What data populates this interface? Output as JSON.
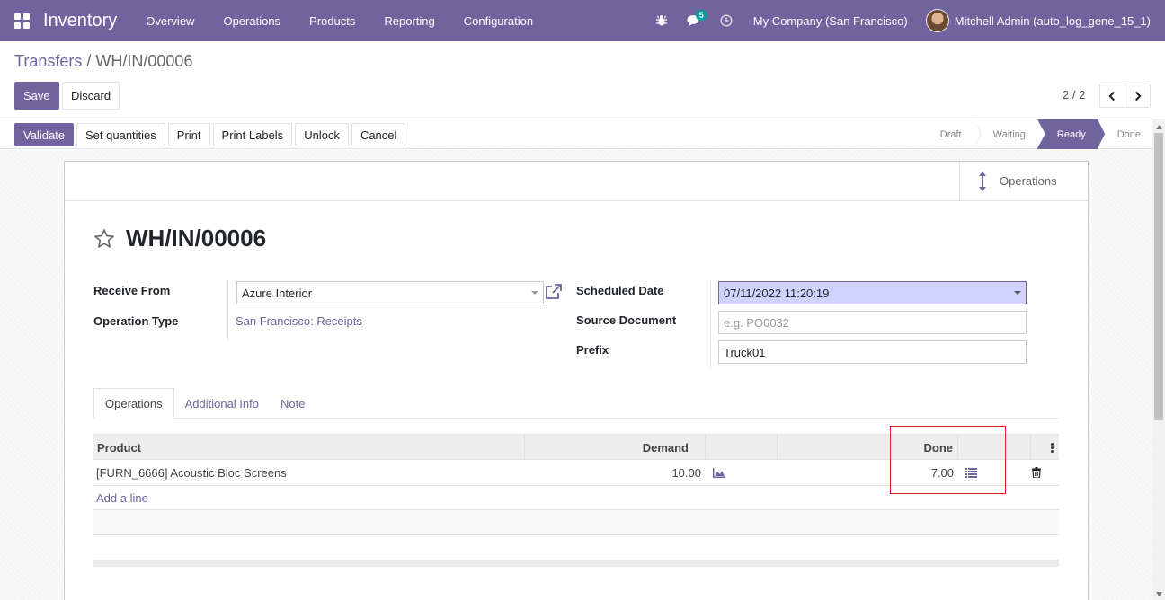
{
  "navbar": {
    "brand": "Inventory",
    "menu": [
      "Overview",
      "Operations",
      "Products",
      "Reporting",
      "Configuration"
    ],
    "chat_badge": "5",
    "company": "My Company (San Francisco)",
    "user": "Mitchell Admin (auto_log_gene_15_1)",
    "colors": {
      "bar": "#71639e"
    }
  },
  "breadcrumb": {
    "parent": "Transfers",
    "separator": "/",
    "current": "WH/IN/00006"
  },
  "actions": {
    "save": "Save",
    "discard": "Discard"
  },
  "pager": {
    "value": "2 / 2"
  },
  "statusbar": {
    "buttons": [
      "Validate",
      "Set quantities",
      "Print",
      "Print Labels",
      "Unlock",
      "Cancel"
    ],
    "stages": [
      "Draft",
      "Waiting",
      "Ready",
      "Done"
    ],
    "active_stage": "Ready"
  },
  "smart_button": {
    "label": "Operations",
    "icon": "arrows-v-icon"
  },
  "record": {
    "title": "WH/IN/00006",
    "receive_from_label": "Receive From",
    "receive_from": "Azure Interior",
    "operation_type_label": "Operation Type",
    "operation_type": "San Francisco: Receipts",
    "scheduled_date_label": "Scheduled Date",
    "scheduled_date": "07/11/2022 11:20:19",
    "source_document_label": "Source Document",
    "source_document_placeholder": "e.g. PO0032",
    "prefix_label": "Prefix",
    "prefix": "Truck01"
  },
  "tabs": [
    "Operations",
    "Additional Info",
    "Note"
  ],
  "table": {
    "headers": {
      "product": "Product",
      "demand": "Demand",
      "done": "Done"
    },
    "rows": [
      {
        "product": "[FURN_6666] Acoustic Bloc Screens",
        "demand": "10.00",
        "done": "7.00"
      }
    ],
    "add_line": "Add a line"
  }
}
